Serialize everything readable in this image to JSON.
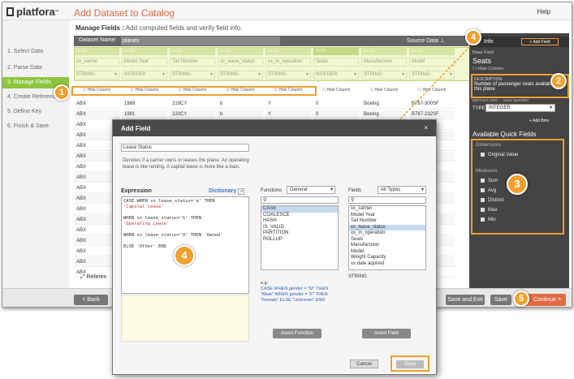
{
  "app": {
    "logo_text": "platfora",
    "logo_tm": "™",
    "title": "Add Dataset to Catalog",
    "help": "Help"
  },
  "steps": [
    {
      "label": "1. Select Data"
    },
    {
      "label": "2. Parse Data"
    },
    {
      "label": "3. Manage Fields"
    },
    {
      "label": "4. Create References"
    },
    {
      "label": "5. Define Key"
    },
    {
      "label": "6. Finish & Save"
    }
  ],
  "active_step": 2,
  "header": {
    "bold": "Manage Fields :",
    "text": "Add computed fields and verify field info."
  },
  "dataset": {
    "name_label": "Dataset Name:",
    "name_value": "planes",
    "source_data": "Source Data ⊥"
  },
  "columns": [
    {
      "base": "BASE",
      "name": "xx_carrier",
      "type": "STRING",
      "hide": "Hide Column",
      "checked": true,
      "values": [
        "ABX",
        "ABX",
        "ABX",
        "ABX",
        "ABX",
        "ABX",
        "ABX",
        "ABX",
        "ABX",
        "ABX",
        "ABX",
        "ABX",
        "ABX",
        "ABX",
        "ABX",
        "ABX",
        "ABX"
      ]
    },
    {
      "base": "BASE",
      "name": "Model Year",
      "type": "INTEGER",
      "hide": "Hide Column",
      "checked": true,
      "values": [
        "1989",
        "1991",
        "",
        "",
        "",
        "",
        "",
        "",
        "",
        "",
        "",
        "",
        "",
        "",
        "",
        "",
        ""
      ]
    },
    {
      "base": "BASE",
      "name": "Tail Number",
      "type": "STRING",
      "hide": "Hide Column",
      "checked": true,
      "values": [
        "219CY",
        "220CY",
        "",
        "",
        "",
        "",
        "",
        "",
        "",
        "",
        "",
        "",
        "",
        "",
        "",
        "",
        ""
      ]
    },
    {
      "base": "BASE",
      "name": "xx_lease_status",
      "type": "STRING",
      "hide": "Hide Column",
      "checked": true,
      "values": [
        "b",
        "b",
        "",
        "",
        "",
        "",
        "",
        "",
        "",
        "",
        "",
        "",
        "",
        "",
        "",
        "",
        ""
      ]
    },
    {
      "base": "BASE",
      "name": "xx_in_operation",
      "type": "STRING",
      "hide": "Hide Column",
      "checked": true,
      "values": [
        "Y",
        "Y",
        "",
        "",
        "",
        "",
        "",
        "",
        "",
        "",
        "",
        "",
        "",
        "",
        "",
        "",
        ""
      ]
    },
    {
      "base": "BASE",
      "name": "Seats",
      "type": "INTEGER",
      "hide": "Hide Column",
      "checked": false,
      "values": [
        "0",
        "0",
        "",
        "",
        "",
        "",
        "",
        "",
        "",
        "",
        "",
        "",
        "",
        "",
        "",
        "",
        ""
      ]
    },
    {
      "base": "BASE",
      "name": "Manufacturer",
      "type": "STRING",
      "hide": "Hide Column",
      "checked": false,
      "values": [
        "Boeing",
        "Boeing",
        "",
        "",
        "",
        "",
        "",
        "",
        "",
        "",
        "",
        "",
        "",
        "",
        "",
        "",
        ""
      ]
    },
    {
      "base": "BASE",
      "name": "Model",
      "type": "STRING",
      "hide": "Hide Column",
      "checked": false,
      "values": [
        "B767-300SF",
        "B767-232SF",
        "",
        "",
        "",
        "",
        "",
        "",
        "",
        "",
        "",
        "",
        "",
        "",
        "",
        "",
        ""
      ]
    }
  ],
  "right_panel": {
    "info_title": "Info",
    "add_field_btn": "+ Add Field",
    "base_field_label": "Base Field",
    "field_name": "Seats",
    "hide_column": "Hide Column",
    "description_label": "DESCRIPTION",
    "description": "Number of passenger seats available on this plane",
    "default_agg": "DEFAULT AGG",
    "default_agg_value": "None Specified",
    "type_label": "TYPE",
    "type_value": "INTEGER",
    "add_bins": "+ Add Bins",
    "quick_fields_title": "Available Quick Fields",
    "dimensions_label": "Dimensions",
    "dimensions": [
      "Original Value"
    ],
    "measures_label": "Measures",
    "measures": [
      "Sum",
      "Avg",
      "Distinct",
      "Max",
      "Min"
    ]
  },
  "bottom": {
    "back": "< Back",
    "references": "Referen",
    "save_exit": "Save and Exit",
    "save": "Save",
    "continue": "Continue >"
  },
  "modal": {
    "title": "Add Field",
    "close": "×",
    "name_value": "Lease Status",
    "description": "Denotes if a carrier owns or leases the plane. An operating lease is like renting. A capital lease is more like a loan.",
    "expression_label": "Expression",
    "dictionary_link": "Dictionary",
    "expression_lines": [
      "CASE WHEN xx_lease_status='a' THEN",
      "'Capital Lease'",
      "",
      "WHEN xx_lease_status='b' THEN",
      "'Operating Lease'",
      "",
      "WHEN xx_lease_status='O' THEN 'Owned'",
      "",
      "ELSE 'Other' END"
    ],
    "functions_label": "Functions",
    "functions_select": "General",
    "functions": [
      "CASE",
      "COALESCE",
      "HASH",
      "IS_VALID",
      "PARTITION",
      "ROLLUP"
    ],
    "fields_label": "Fields",
    "fields_select": "All Types",
    "fields": [
      "xx_carrier",
      "Model Year",
      "Tail Number",
      "xx_lease_status",
      "xx_in_operation",
      "Seats",
      "Manufacturer",
      "Model",
      "Weight Capacity",
      "xx date aquired"
    ],
    "field_type": "STRING",
    "example_label": "e.g.",
    "example": "CASE WHEN gender = \"M\" THEN \"Male\" WHEN gender = \"F\" THEN \"Female\" ELSE \"Unknown\" END",
    "insert_function": "Insert Function",
    "insert_field": "Insert Field",
    "cancel": "Cancel",
    "save": "Save"
  },
  "callouts": [
    "1",
    "2",
    "3",
    "4",
    "4",
    "5"
  ],
  "colors": {
    "accent": "#e06a43",
    "highlight": "#f0a030",
    "active_step": "#8cc63f",
    "base_tag": "#c4d79b"
  }
}
